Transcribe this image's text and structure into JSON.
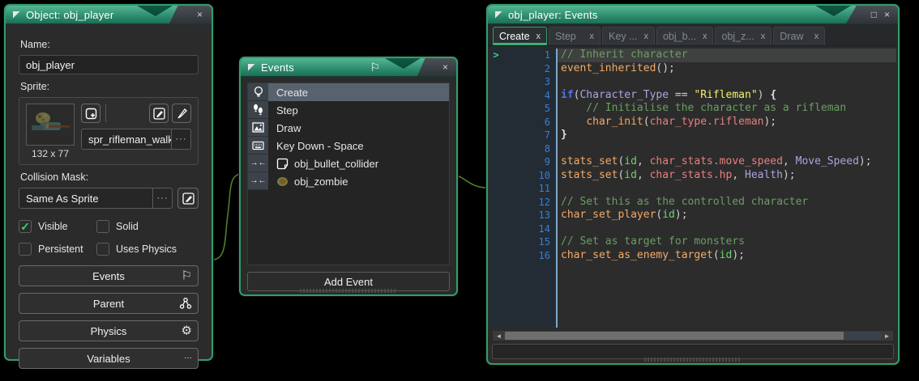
{
  "icons": {
    "close": "×",
    "close_small": "x",
    "maximize": "□",
    "flag": "⚐",
    "gear": "⚙",
    "ellipsis": "···",
    "check": "✓",
    "collision": "→←",
    "marker": ">",
    "scroll_left": "◄",
    "scroll_right": "►"
  },
  "object_panel": {
    "title": "Object: obj_player",
    "name_label": "Name:",
    "name_value": "obj_player",
    "sprite_label": "Sprite:",
    "sprite_dims": "132 x 77",
    "sprite_name": "spr_rifleman_walk",
    "collision_label": "Collision Mask:",
    "collision_value": "Same As Sprite",
    "checkboxes": [
      {
        "label": "Visible",
        "checked": true
      },
      {
        "label": "Solid",
        "checked": false
      },
      {
        "label": "Persistent",
        "checked": false
      },
      {
        "label": "Uses Physics",
        "checked": false
      }
    ],
    "action_buttons": [
      {
        "label": "Events",
        "icon": "flag-icon"
      },
      {
        "label": "Parent",
        "icon": "parent-icon"
      },
      {
        "label": "Physics",
        "icon": "physics-icon"
      },
      {
        "label": "Variables",
        "icon": "ellipsis-icon"
      }
    ]
  },
  "events_panel": {
    "title": "Events",
    "items": [
      {
        "label": "Create",
        "icon": "lightbulb-icon",
        "selected": true
      },
      {
        "label": "Step",
        "icon": "footsteps-icon",
        "selected": false
      },
      {
        "label": "Draw",
        "icon": "image-icon",
        "selected": false
      },
      {
        "label": "Key Down - Space",
        "icon": "keyboard-icon",
        "selected": false
      },
      {
        "label": "obj_bullet_collider",
        "icon": "collision-icon",
        "sub_icon": "object-icon",
        "selected": false
      },
      {
        "label": "obj_zombie",
        "icon": "collision-icon",
        "sub_icon": "zombie-sprite-icon",
        "selected": false
      }
    ],
    "add_event_label": "Add Event"
  },
  "code_panel": {
    "title": "obj_player: Events",
    "tabs": [
      {
        "label": "Create",
        "active": true
      },
      {
        "label": "Step",
        "active": false
      },
      {
        "label": "Key ...",
        "active": false
      },
      {
        "label": "obj_b...",
        "active": false
      },
      {
        "label": "obj_z...",
        "active": false
      },
      {
        "label": "Draw",
        "active": false
      }
    ],
    "code_lines": [
      {
        "n": 1,
        "current": true,
        "tokens": [
          {
            "t": "// Inherit character",
            "c": "comment"
          }
        ]
      },
      {
        "n": 2,
        "current": false,
        "tokens": [
          {
            "t": "event_inherited",
            "c": "func"
          },
          {
            "t": "();",
            "c": "plain"
          }
        ]
      },
      {
        "n": 3,
        "current": false,
        "tokens": []
      },
      {
        "n": 4,
        "current": false,
        "tokens": [
          {
            "t": "if",
            "c": "keyword"
          },
          {
            "t": "(",
            "c": "plain"
          },
          {
            "t": "Character_Type",
            "c": "global"
          },
          {
            "t": " == ",
            "c": "plain"
          },
          {
            "t": "\"Rifleman\"",
            "c": "string"
          },
          {
            "t": ") ",
            "c": "plain"
          },
          {
            "t": "{",
            "c": "brace"
          }
        ]
      },
      {
        "n": 5,
        "current": false,
        "tokens": [
          {
            "t": "    // Initialise the character as a rifleman",
            "c": "comment"
          }
        ]
      },
      {
        "n": 6,
        "current": false,
        "tokens": [
          {
            "t": "    ",
            "c": "plain"
          },
          {
            "t": "char_init",
            "c": "func"
          },
          {
            "t": "(",
            "c": "plain"
          },
          {
            "t": "char_type.rifleman",
            "c": "enum"
          },
          {
            "t": ");",
            "c": "plain"
          }
        ]
      },
      {
        "n": 7,
        "current": false,
        "tokens": [
          {
            "t": "}",
            "c": "brace"
          }
        ]
      },
      {
        "n": 8,
        "current": false,
        "tokens": []
      },
      {
        "n": 9,
        "current": false,
        "tokens": [
          {
            "t": "stats_set",
            "c": "func"
          },
          {
            "t": "(",
            "c": "plain"
          },
          {
            "t": "id",
            "c": "builtin"
          },
          {
            "t": ", ",
            "c": "plain"
          },
          {
            "t": "char_stats.move_speed",
            "c": "enum"
          },
          {
            "t": ", ",
            "c": "plain"
          },
          {
            "t": "Move_Speed",
            "c": "global"
          },
          {
            "t": ");",
            "c": "plain"
          }
        ]
      },
      {
        "n": 10,
        "current": false,
        "tokens": [
          {
            "t": "stats_set",
            "c": "func"
          },
          {
            "t": "(",
            "c": "plain"
          },
          {
            "t": "id",
            "c": "builtin"
          },
          {
            "t": ", ",
            "c": "plain"
          },
          {
            "t": "char_stats.hp",
            "c": "enum"
          },
          {
            "t": ", ",
            "c": "plain"
          },
          {
            "t": "Health",
            "c": "global"
          },
          {
            "t": ");",
            "c": "plain"
          }
        ]
      },
      {
        "n": 11,
        "current": false,
        "tokens": []
      },
      {
        "n": 12,
        "current": false,
        "tokens": [
          {
            "t": "// Set this as the controlled character",
            "c": "comment"
          }
        ]
      },
      {
        "n": 13,
        "current": false,
        "tokens": [
          {
            "t": "char_set_player",
            "c": "func"
          },
          {
            "t": "(",
            "c": "plain"
          },
          {
            "t": "id",
            "c": "builtin"
          },
          {
            "t": ");",
            "c": "plain"
          }
        ]
      },
      {
        "n": 14,
        "current": false,
        "tokens": []
      },
      {
        "n": 15,
        "current": false,
        "tokens": [
          {
            "t": "// Set as target for monsters",
            "c": "comment"
          }
        ]
      },
      {
        "n": 16,
        "current": false,
        "tokens": [
          {
            "t": "char_set_as_enemy_target",
            "c": "func"
          },
          {
            "t": "(",
            "c": "plain"
          },
          {
            "t": "id",
            "c": "builtin"
          },
          {
            "t": ");",
            "c": "plain"
          }
        ]
      }
    ]
  },
  "colors": {
    "accent_green": "#2f9e6a",
    "titlebar_teal": "#2f8f70",
    "wire_green": "#4f7d2a",
    "selected_row": "#57626e",
    "check_green": "#3ecf70"
  }
}
